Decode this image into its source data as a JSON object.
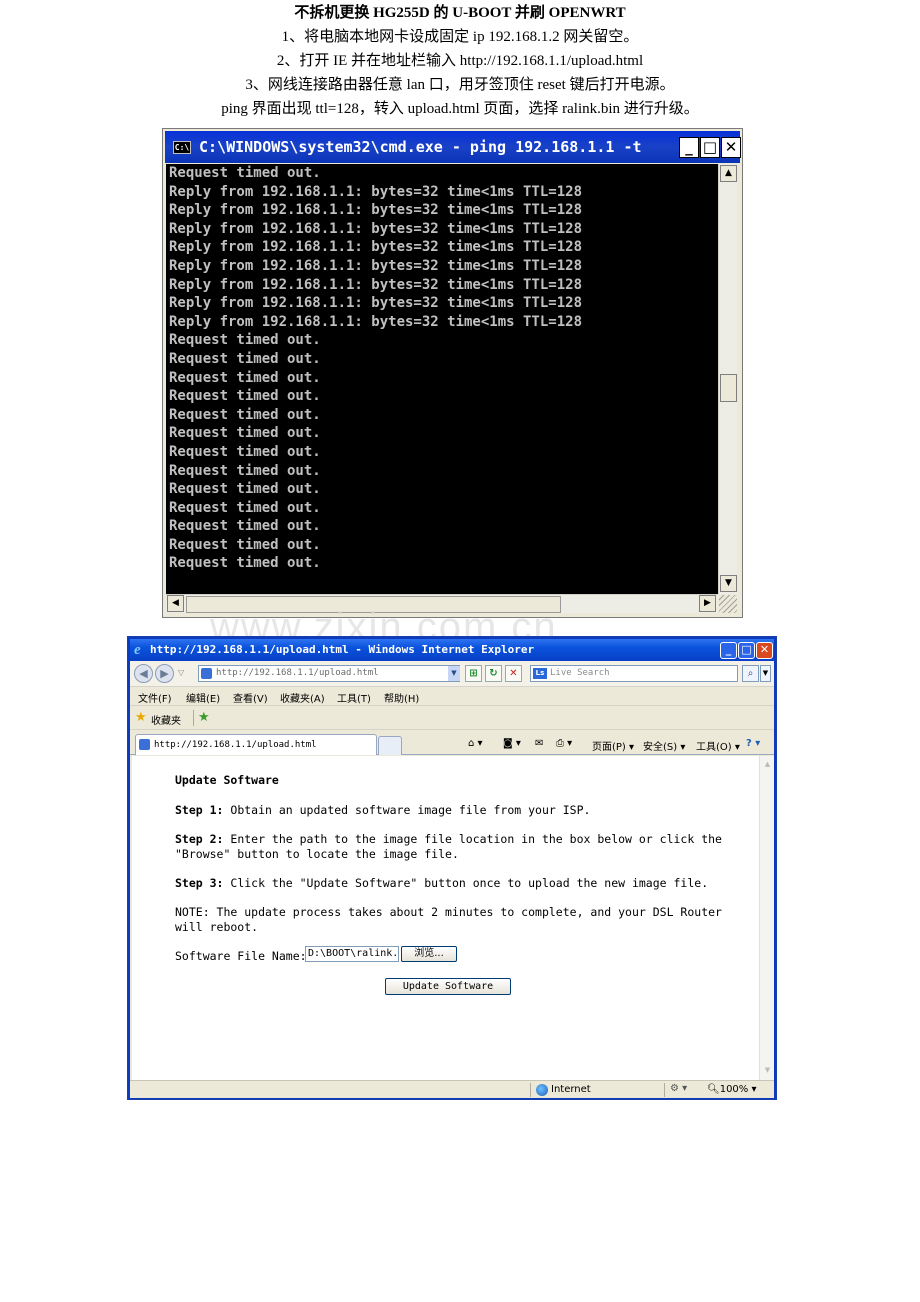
{
  "doc": {
    "title": "不拆机更换 HG255D 的 U-BOOT 并刷 OPENWRT",
    "lines": [
      "1、将电脑本地网卡设成固定 ip 192.168.1.2  网关留空。",
      "2、打开 IE 并在地址栏输入 http://192.168.1.1/upload.html",
      "3、网线连接路由器任意 lan 口，用牙签顶住 reset 键后打开电源。",
      "ping 界面出现 ttl=128，转入 upload.html 页面，选择 ralink.bin 进行升级。"
    ],
    "watermark": "www.zixin.com.cn"
  },
  "cmd_window": {
    "title": "C:\\WINDOWS\\system32\\cmd.exe - ping 192.168.1.1 -t",
    "icon_label": "C:\\",
    "lines": [
      "Request timed out.",
      "Reply from 192.168.1.1: bytes=32 time<1ms TTL=128",
      "Reply from 192.168.1.1: bytes=32 time<1ms TTL=128",
      "Reply from 192.168.1.1: bytes=32 time<1ms TTL=128",
      "Reply from 192.168.1.1: bytes=32 time<1ms TTL=128",
      "Reply from 192.168.1.1: bytes=32 time<1ms TTL=128",
      "Reply from 192.168.1.1: bytes=32 time<1ms TTL=128",
      "Reply from 192.168.1.1: bytes=32 time<1ms TTL=128",
      "Reply from 192.168.1.1: bytes=32 time<1ms TTL=128",
      "Request timed out.",
      "Request timed out.",
      "Request timed out.",
      "Request timed out.",
      "Request timed out.",
      "Request timed out.",
      "Request timed out.",
      "Request timed out.",
      "Request timed out.",
      "Request timed out.",
      "Request timed out.",
      "Request timed out.",
      "Request timed out."
    ],
    "window_buttons": {
      "minimize": "_",
      "maximize": "□",
      "close": "✕"
    },
    "colors": {
      "titlebar": "#0831d9",
      "console_bg": "#000000",
      "console_text": "#c0c0c0"
    }
  },
  "ie_window": {
    "title": "http://192.168.1.1/upload.html - Windows Internet Explorer",
    "address": "http://192.168.1.1/upload.html",
    "search_placeholder": "Live Search",
    "search_logo": "Ls",
    "menu": [
      "文件(F)",
      "编辑(E)",
      "查看(V)",
      "收藏夹(A)",
      "工具(T)",
      "帮助(H)"
    ],
    "favorites_label": "收藏夹",
    "tab_title": "http://192.168.1.1/upload.html",
    "command_bar": {
      "page": "页面(P) ▾",
      "safety": "安全(S) ▾",
      "tools": "工具(O) ▾"
    },
    "page": {
      "heading": "Update Software",
      "step1_label": "Step 1:",
      "step1_text": " Obtain an updated software image file from your ISP.",
      "step2_label": "Step 2:",
      "step2_text": " Enter the path to the image file location in the box below or click the\n\"Browse\" button to locate the image file.",
      "step3_label": "Step 3:",
      "step3_text": " Click the \"Update Software\" button once to upload the new image file.",
      "note": "NOTE: The update process takes about 2 minutes to complete, and your DSL Router\nwill reboot.",
      "file_label": "Software File Name:",
      "file_value": "D:\\BOOT\\ralink.bin",
      "browse_label": "浏览...",
      "update_label": "Update Software"
    },
    "status": {
      "zone": "Internet",
      "zoom": "100%"
    },
    "colors": {
      "titlebar": "#0a52dc"
    }
  }
}
